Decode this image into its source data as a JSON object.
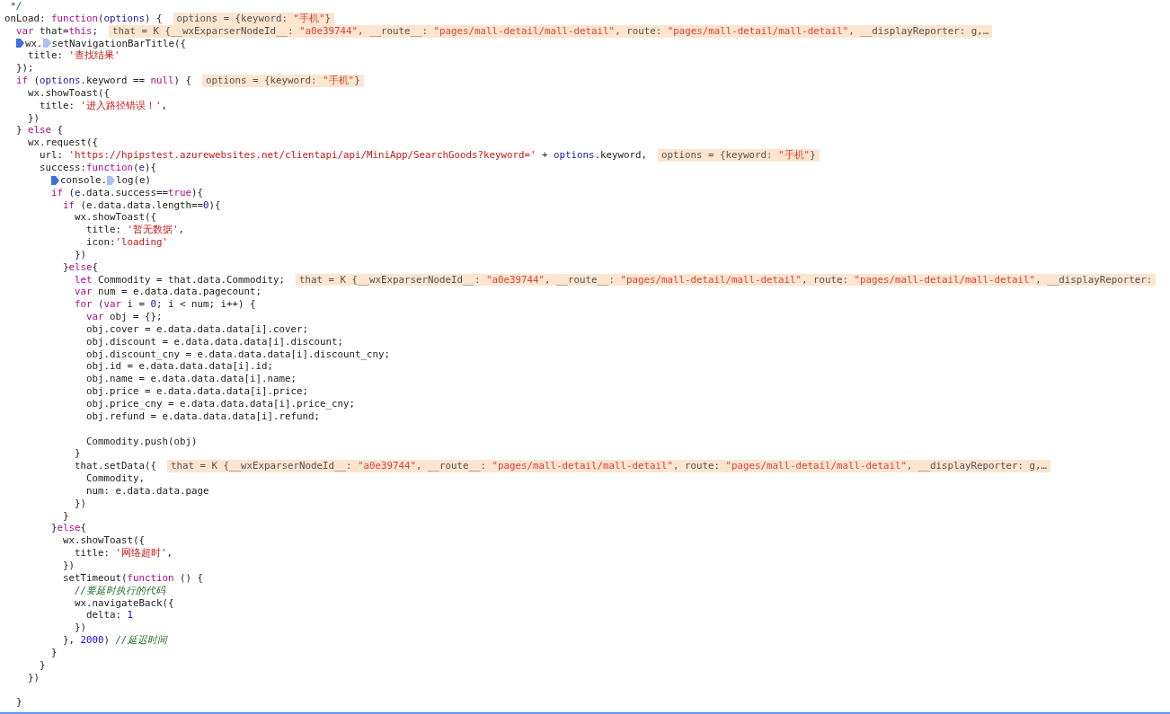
{
  "editor": {
    "lines": [
      {
        "code": [
          {
            "kind": "com",
            "text": " */"
          }
        ]
      },
      {
        "code": [
          {
            "kind": "plain",
            "text": "onLoad: "
          },
          {
            "kind": "kw",
            "text": "function"
          },
          {
            "kind": "plain",
            "text": "("
          },
          {
            "kind": "var",
            "text": "options"
          },
          {
            "kind": "plain",
            "text": ") {"
          }
        ],
        "inline": [
          {
            "kind": "key",
            "text": "options = {keyword: "
          },
          {
            "kind": "str",
            "text": "\"手机\""
          },
          {
            "kind": "key",
            "text": "}"
          }
        ]
      },
      {
        "code": [
          {
            "kind": "kw",
            "text": "  var"
          },
          {
            "kind": "plain",
            "text": " that="
          },
          {
            "kind": "kw",
            "text": "this"
          },
          {
            "kind": "plain",
            "text": ";"
          }
        ],
        "inline": [
          {
            "kind": "key",
            "text": "that = K {__wxExparserNodeId__: "
          },
          {
            "kind": "str",
            "text": "\"a0e39744\""
          },
          {
            "kind": "key",
            "text": ", __route__: "
          },
          {
            "kind": "str",
            "text": "\"pages/mall-detail/mall-detail\""
          },
          {
            "kind": "key",
            "text": ", route: "
          },
          {
            "kind": "str",
            "text": "\"pages/mall-detail/mall-detail\""
          },
          {
            "kind": "key",
            "text": ", __displayReporter: g,…"
          }
        ]
      },
      {
        "code": [
          {
            "kind": "bp",
            "on": true,
            "text": "  wx."
          },
          {
            "kind": "bp",
            "on": false,
            "text": "setNavigationBarTitle({"
          }
        ]
      },
      {
        "code": [
          {
            "kind": "plain",
            "text": "    title: "
          },
          {
            "kind": "str",
            "text": "'查找结果'"
          }
        ]
      },
      {
        "code": [
          {
            "kind": "plain",
            "text": "  });"
          }
        ]
      },
      {
        "code": [
          {
            "kind": "kw",
            "text": "  if"
          },
          {
            "kind": "plain",
            "text": " ("
          },
          {
            "kind": "var",
            "text": "options"
          },
          {
            "kind": "plain",
            "text": ".keyword == "
          },
          {
            "kind": "kw",
            "text": "null"
          },
          {
            "kind": "plain",
            "text": ") {"
          }
        ],
        "inline": [
          {
            "kind": "key",
            "text": "options = {keyword: "
          },
          {
            "kind": "str",
            "text": "\"手机\""
          },
          {
            "kind": "key",
            "text": "}"
          }
        ]
      },
      {
        "code": [
          {
            "kind": "plain",
            "text": "    wx.showToast({"
          }
        ]
      },
      {
        "code": [
          {
            "kind": "plain",
            "text": "      title: "
          },
          {
            "kind": "str",
            "text": "'进入路径错误！'"
          },
          {
            "kind": "plain",
            "text": ","
          }
        ]
      },
      {
        "code": [
          {
            "kind": "plain",
            "text": "    })"
          }
        ]
      },
      {
        "code": [
          {
            "kind": "plain",
            "text": "  } "
          },
          {
            "kind": "kw",
            "text": "else"
          },
          {
            "kind": "plain",
            "text": " {"
          }
        ]
      },
      {
        "code": [
          {
            "kind": "plain",
            "text": "    wx.request({"
          }
        ]
      },
      {
        "code": [
          {
            "kind": "plain",
            "text": "      url: "
          },
          {
            "kind": "str",
            "text": "'https://hpipstest.azurewebsites.net/clientapi/api/MiniApp/SearchGoods?keyword='"
          },
          {
            "kind": "plain",
            "text": " + "
          },
          {
            "kind": "var",
            "text": "options"
          },
          {
            "kind": "plain",
            "text": ".keyword,"
          }
        ],
        "inline": [
          {
            "kind": "key",
            "text": "options = {keyword: "
          },
          {
            "kind": "str",
            "text": "\"手机\""
          },
          {
            "kind": "key",
            "text": "}"
          }
        ]
      },
      {
        "code": [
          {
            "kind": "plain",
            "text": "      success:"
          },
          {
            "kind": "kw",
            "text": "function"
          },
          {
            "kind": "plain",
            "text": "("
          },
          {
            "kind": "var",
            "text": "e"
          },
          {
            "kind": "plain",
            "text": "){"
          }
        ]
      },
      {
        "code": [
          {
            "kind": "bp",
            "on": true,
            "text": "        console."
          },
          {
            "kind": "bp",
            "on": false,
            "text": "log(e)"
          }
        ]
      },
      {
        "code": [
          {
            "kind": "kw",
            "text": "        if"
          },
          {
            "kind": "plain",
            "text": " ("
          },
          {
            "kind": "var",
            "text": "e"
          },
          {
            "kind": "plain",
            "text": ".data.success=="
          },
          {
            "kind": "kw",
            "text": "true"
          },
          {
            "kind": "plain",
            "text": "){"
          }
        ]
      },
      {
        "code": [
          {
            "kind": "kw",
            "text": "          if"
          },
          {
            "kind": "plain",
            "text": " (e.data.data.length=="
          },
          {
            "kind": "num",
            "text": "0"
          },
          {
            "kind": "plain",
            "text": "){"
          }
        ]
      },
      {
        "code": [
          {
            "kind": "plain",
            "text": "            wx.showToast({"
          }
        ]
      },
      {
        "code": [
          {
            "kind": "plain",
            "text": "              title: "
          },
          {
            "kind": "str",
            "text": "'暂无数据'"
          },
          {
            "kind": "plain",
            "text": ","
          }
        ]
      },
      {
        "code": [
          {
            "kind": "plain",
            "text": "              icon:"
          },
          {
            "kind": "str",
            "text": "'loading'"
          }
        ]
      },
      {
        "code": [
          {
            "kind": "plain",
            "text": "            })"
          }
        ]
      },
      {
        "code": [
          {
            "kind": "plain",
            "text": "          }"
          },
          {
            "kind": "kw",
            "text": "else"
          },
          {
            "kind": "plain",
            "text": "{"
          }
        ]
      },
      {
        "code": [
          {
            "kind": "kw",
            "text": "            let"
          },
          {
            "kind": "plain",
            "text": " Commodity = that.data.Commodity;"
          }
        ],
        "inline": [
          {
            "kind": "key",
            "text": "that = K {__wxExparserNodeId__: "
          },
          {
            "kind": "str",
            "text": "\"a0e39744\""
          },
          {
            "kind": "key",
            "text": ", __route__: "
          },
          {
            "kind": "str",
            "text": "\"pages/mall-detail/mall-detail\""
          },
          {
            "kind": "key",
            "text": ", route: "
          },
          {
            "kind": "str",
            "text": "\"pages/mall-detail/mall-detail\""
          },
          {
            "kind": "key",
            "text": ", __displayReporter:"
          }
        ]
      },
      {
        "code": [
          {
            "kind": "kw",
            "text": "            var"
          },
          {
            "kind": "plain",
            "text": " num = e.data.data.pagecount;"
          }
        ]
      },
      {
        "code": [
          {
            "kind": "kw",
            "text": "            for"
          },
          {
            "kind": "plain",
            "text": " ("
          },
          {
            "kind": "kw",
            "text": "var"
          },
          {
            "kind": "plain",
            "text": " i = "
          },
          {
            "kind": "num",
            "text": "0"
          },
          {
            "kind": "plain",
            "text": "; i < num; i++) {"
          }
        ]
      },
      {
        "code": [
          {
            "kind": "kw",
            "text": "              var"
          },
          {
            "kind": "plain",
            "text": " obj = {};"
          }
        ]
      },
      {
        "code": [
          {
            "kind": "plain",
            "text": "              obj.cover = e.data.data.data[i].cover;"
          }
        ]
      },
      {
        "code": [
          {
            "kind": "plain",
            "text": "              obj.discount = e.data.data.data[i].discount;"
          }
        ]
      },
      {
        "code": [
          {
            "kind": "plain",
            "text": "              obj.discount_cny = e.data.data.data[i].discount_cny;"
          }
        ]
      },
      {
        "code": [
          {
            "kind": "plain",
            "text": "              obj.id = e.data.data.data[i].id;"
          }
        ]
      },
      {
        "code": [
          {
            "kind": "plain",
            "text": "              obj.name = e.data.data.data[i].name;"
          }
        ]
      },
      {
        "code": [
          {
            "kind": "plain",
            "text": "              obj.price = e.data.data.data[i].price;"
          }
        ]
      },
      {
        "code": [
          {
            "kind": "plain",
            "text": "              obj.price_cny = e.data.data.data[i].price_cny;"
          }
        ]
      },
      {
        "code": [
          {
            "kind": "plain",
            "text": "              obj.refund = e.data.data.data[i].refund;"
          }
        ],
        "blank_after": true
      },
      {
        "code": [
          {
            "kind": "plain",
            "text": "              Commodity.push(obj)"
          }
        ]
      },
      {
        "code": [
          {
            "kind": "plain",
            "text": "            }"
          }
        ]
      },
      {
        "code": [
          {
            "kind": "plain",
            "text": "            that.setData({"
          }
        ],
        "inline": [
          {
            "kind": "key",
            "text": "that = K {__wxExparserNodeId__: "
          },
          {
            "kind": "str",
            "text": "\"a0e39744\""
          },
          {
            "kind": "key",
            "text": ", __route__: "
          },
          {
            "kind": "str",
            "text": "\"pages/mall-detail/mall-detail\""
          },
          {
            "kind": "key",
            "text": ", route: "
          },
          {
            "kind": "str",
            "text": "\"pages/mall-detail/mall-detail\""
          },
          {
            "kind": "key",
            "text": ", __displayReporter: g,…"
          }
        ]
      },
      {
        "code": [
          {
            "kind": "plain",
            "text": "              Commodity,"
          }
        ]
      },
      {
        "code": [
          {
            "kind": "plain",
            "text": "              num: e.data.data.page"
          }
        ]
      },
      {
        "code": [
          {
            "kind": "plain",
            "text": "            })"
          }
        ]
      },
      {
        "code": [
          {
            "kind": "plain",
            "text": "          }"
          }
        ]
      },
      {
        "code": [
          {
            "kind": "plain",
            "text": "        }"
          },
          {
            "kind": "kw",
            "text": "else"
          },
          {
            "kind": "plain",
            "text": "{"
          }
        ]
      },
      {
        "code": [
          {
            "kind": "plain",
            "text": "          wx.showToast({"
          }
        ]
      },
      {
        "code": [
          {
            "kind": "plain",
            "text": "            title: "
          },
          {
            "kind": "str",
            "text": "'网络超时'"
          },
          {
            "kind": "plain",
            "text": ","
          }
        ]
      },
      {
        "code": [
          {
            "kind": "plain",
            "text": "          })"
          }
        ]
      },
      {
        "code": [
          {
            "kind": "plain",
            "text": "          setTimeout("
          },
          {
            "kind": "kw",
            "text": "function"
          },
          {
            "kind": "plain",
            "text": " () {"
          }
        ]
      },
      {
        "code": [
          {
            "kind": "com",
            "text": "            //要延时执行的代码"
          }
        ]
      },
      {
        "code": [
          {
            "kind": "plain",
            "text": "            wx.navigateBack({"
          }
        ]
      },
      {
        "code": [
          {
            "kind": "plain",
            "text": "              delta: "
          },
          {
            "kind": "num",
            "text": "1"
          }
        ]
      },
      {
        "code": [
          {
            "kind": "plain",
            "text": "            })"
          }
        ]
      },
      {
        "code": [
          {
            "kind": "plain",
            "text": "          }, "
          },
          {
            "kind": "num",
            "text": "2000"
          },
          {
            "kind": "plain",
            "text": ") "
          },
          {
            "kind": "com",
            "text": "//延迟时间"
          }
        ]
      },
      {
        "code": [
          {
            "kind": "plain",
            "text": "        }"
          }
        ]
      },
      {
        "code": [
          {
            "kind": "plain",
            "text": "      }"
          }
        ]
      },
      {
        "code": [
          {
            "kind": "plain",
            "text": "    })"
          }
        ],
        "blank_after": true
      },
      {
        "code": [
          {
            "kind": "plain",
            "text": "  }"
          }
        ]
      }
    ]
  }
}
